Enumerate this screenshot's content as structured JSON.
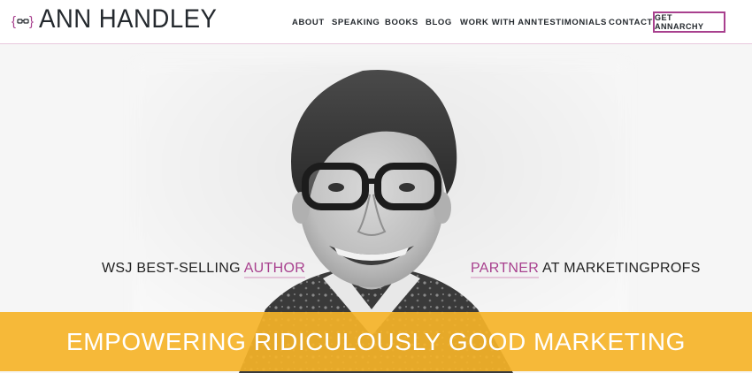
{
  "brand": {
    "logo_icon": "glasses-brackets-icon",
    "name": "ANN HANDLEY",
    "accent_color": "#a8408e",
    "text_color": "#24292e"
  },
  "nav": {
    "items": [
      {
        "label": "ABOUT"
      },
      {
        "label": "SPEAKING"
      },
      {
        "label": "BOOKS"
      },
      {
        "label": "BLOG"
      },
      {
        "label": "WORK WITH ANN"
      },
      {
        "label": "TESTIMONIALS"
      },
      {
        "label": "CONTACT"
      }
    ],
    "cta_label": "GET ANNARCHY"
  },
  "hero": {
    "left_claim": {
      "prefix": "WSJ BEST-SELLING ",
      "accent": "AUTHOR"
    },
    "right_claim": {
      "accent": "PARTNER",
      "suffix": " AT MARKETINGPROFS"
    },
    "banner_text": "EMPOWERING RIDICULOUSLY GOOD MARKETING",
    "banner_color": "#f5b328"
  }
}
